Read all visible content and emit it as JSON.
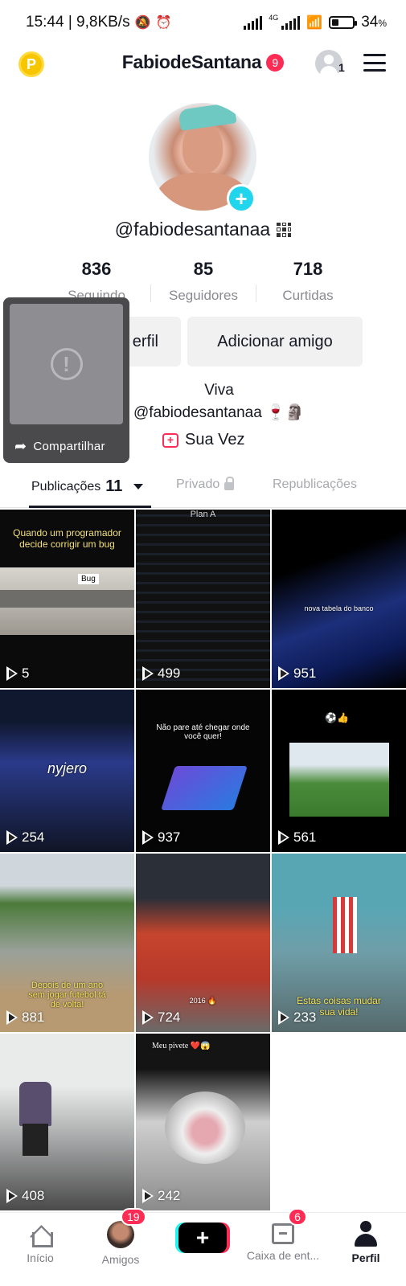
{
  "status_bar": {
    "time_speed": "15:44 | 9,8KB/s",
    "network": "4G",
    "battery": "34",
    "battery_unit": "%",
    "battery_level": 0.34
  },
  "header": {
    "username": "FabiodeSantana",
    "username_badge": "9",
    "coin_label": "P",
    "account_count": "1"
  },
  "profile": {
    "handle": "@fabiodesantanaa",
    "stats": [
      {
        "value": "836",
        "label": "Seguindo"
      },
      {
        "value": "85",
        "label": "Seguidores"
      },
      {
        "value": "718",
        "label": "Curtidas"
      }
    ],
    "edit_button": "Editar perfil",
    "edit_button_visible": "erfil",
    "add_friend_button": "Adicionar amigo",
    "bio_line1": "Viva",
    "bio_line2": "@fabiodesantanaa 🍷🗿",
    "link_label": "Sua Vez"
  },
  "share_popup": {
    "label": "Compartilhar"
  },
  "tabs": [
    {
      "label": "Publicações",
      "count": "11",
      "active": true
    },
    {
      "label": "Privado",
      "active": false
    },
    {
      "label": "Republicações",
      "active": false
    }
  ],
  "videos": [
    {
      "views": "5",
      "caption": "Quando um programador decide corrigir um bug",
      "tag": "Bug"
    },
    {
      "views": "499",
      "caption": "Plan A"
    },
    {
      "views": "951",
      "caption": "nova tabela do banco"
    },
    {
      "views": "254",
      "caption": "nyjero"
    },
    {
      "views": "937",
      "caption": "Não pare até chegar onde você quer!"
    },
    {
      "views": "561",
      "caption": "⚽👍"
    },
    {
      "views": "881",
      "caption": "Depois de um ano sem jogar futebol tá de volta!"
    },
    {
      "views": "724",
      "caption": "2016 🔥"
    },
    {
      "views": "233",
      "caption": "Estas coisas mudar sua vida!"
    },
    {
      "views": "408",
      "caption": ""
    },
    {
      "views": "242",
      "caption": "Meu pivete ❤️😱"
    }
  ],
  "bottom_nav": [
    {
      "label": "Início",
      "icon": "home-icon"
    },
    {
      "label": "Amigos",
      "icon": "friends-avatar",
      "badge": "19"
    },
    {
      "label": "",
      "icon": "create-plus-icon"
    },
    {
      "label": "Caixa de ent...",
      "icon": "inbox-icon",
      "badge": "6"
    },
    {
      "label": "Perfil",
      "icon": "profile-icon",
      "active": true
    }
  ],
  "colors": {
    "accent_red": "#fe2c55",
    "accent_cyan": "#20d5ec",
    "text": "#161823",
    "muted": "#8a8b91"
  }
}
